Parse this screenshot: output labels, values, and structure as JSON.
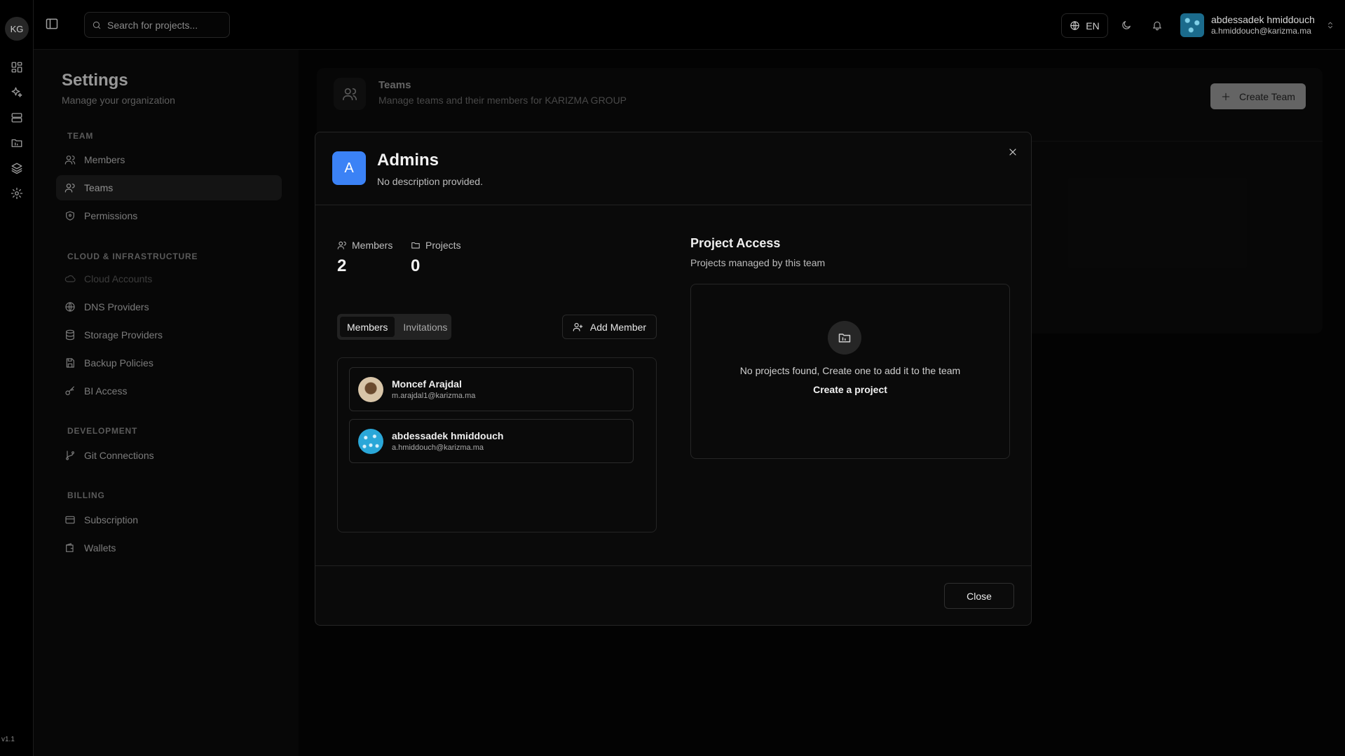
{
  "rail": {
    "logo": "KG",
    "version": "v1.1",
    "icons": [
      "dashboard-icon",
      "sparkles-icon",
      "server-icon",
      "folder-icon",
      "layers-icon",
      "gear-icon"
    ]
  },
  "topbar": {
    "search_placeholder": "Search for projects...",
    "language": "EN",
    "user": {
      "name": "abdessadek hmiddouch",
      "email": "a.hmiddouch@karizma.ma"
    }
  },
  "settings": {
    "title": "Settings",
    "subtitle": "Manage your organization",
    "sections": [
      {
        "heading": "TEAM",
        "items": [
          {
            "label": "Members",
            "icon": "users-icon"
          },
          {
            "label": "Teams",
            "icon": "team-icon",
            "active": true
          },
          {
            "label": "Permissions",
            "icon": "shield-icon"
          }
        ]
      },
      {
        "heading": "CLOUD & INFRASTRUCTURE",
        "items": [
          {
            "label": "Cloud Accounts",
            "icon": "cloud-icon",
            "disabled": true
          },
          {
            "label": "DNS Providers",
            "icon": "globe-icon"
          },
          {
            "label": "Storage Providers",
            "icon": "database-icon"
          },
          {
            "label": "Backup Policies",
            "icon": "save-icon"
          },
          {
            "label": "BI Access",
            "icon": "key-icon"
          }
        ]
      },
      {
        "heading": "DEVELOPMENT",
        "items": [
          {
            "label": "Git Connections",
            "icon": "git-branch-icon"
          }
        ]
      },
      {
        "heading": "BILLING",
        "items": [
          {
            "label": "Subscription",
            "icon": "credit-card-icon"
          },
          {
            "label": "Wallets",
            "icon": "wallet-icon"
          }
        ]
      }
    ]
  },
  "teams_page": {
    "title": "Teams",
    "subtitle": "Manage teams and their members for KARIZMA GROUP",
    "create_button": "Create Team"
  },
  "modal": {
    "team_initial": "A",
    "team_name": "Admins",
    "team_description": "No description provided.",
    "stats": {
      "members_label": "Members",
      "members_value": "2",
      "projects_label": "Projects",
      "projects_value": "0"
    },
    "tabs": [
      {
        "label": "Members",
        "active": true
      },
      {
        "label": "Invitations",
        "active": false
      }
    ],
    "add_member_label": "Add Member",
    "members": [
      {
        "name": "Moncef Arajdal",
        "email": "m.arajdal1@karizma.ma"
      },
      {
        "name": "abdessadek hmiddouch",
        "email": "a.hmiddouch@karizma.ma"
      }
    ],
    "project_access": {
      "title": "Project Access",
      "subtitle": "Projects managed by this team",
      "empty_text": "No projects found, Create one to add it to the team",
      "create_link": "Create a project"
    },
    "close_label": "Close"
  }
}
